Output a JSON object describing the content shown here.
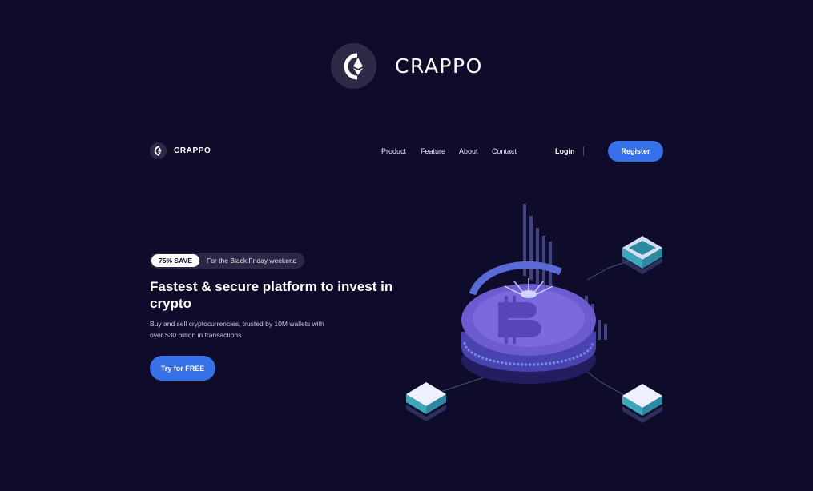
{
  "brand": {
    "name": "CRAPPO"
  },
  "nav": {
    "brand": "CRAPPO",
    "links": [
      "Product",
      "Feature",
      "About",
      "Contact"
    ],
    "login": "Login",
    "register": "Register"
  },
  "hero": {
    "badge_pill": "75% SAVE",
    "badge_text": "For the Black Friday weekend",
    "headline": "Fastest & secure platform to invest in crypto",
    "subtext": "Buy and sell cryptocurrencies, trusted by 10M wallets with over $30 billion in transactions.",
    "cta": "Try for FREE"
  },
  "colors": {
    "background": "#0e0c2a",
    "accent": "#3671e9",
    "coin": "#6d5bd0"
  },
  "icons": [
    "crappo-logo-icon",
    "ethereum-icon",
    "bitcoin-icon"
  ]
}
